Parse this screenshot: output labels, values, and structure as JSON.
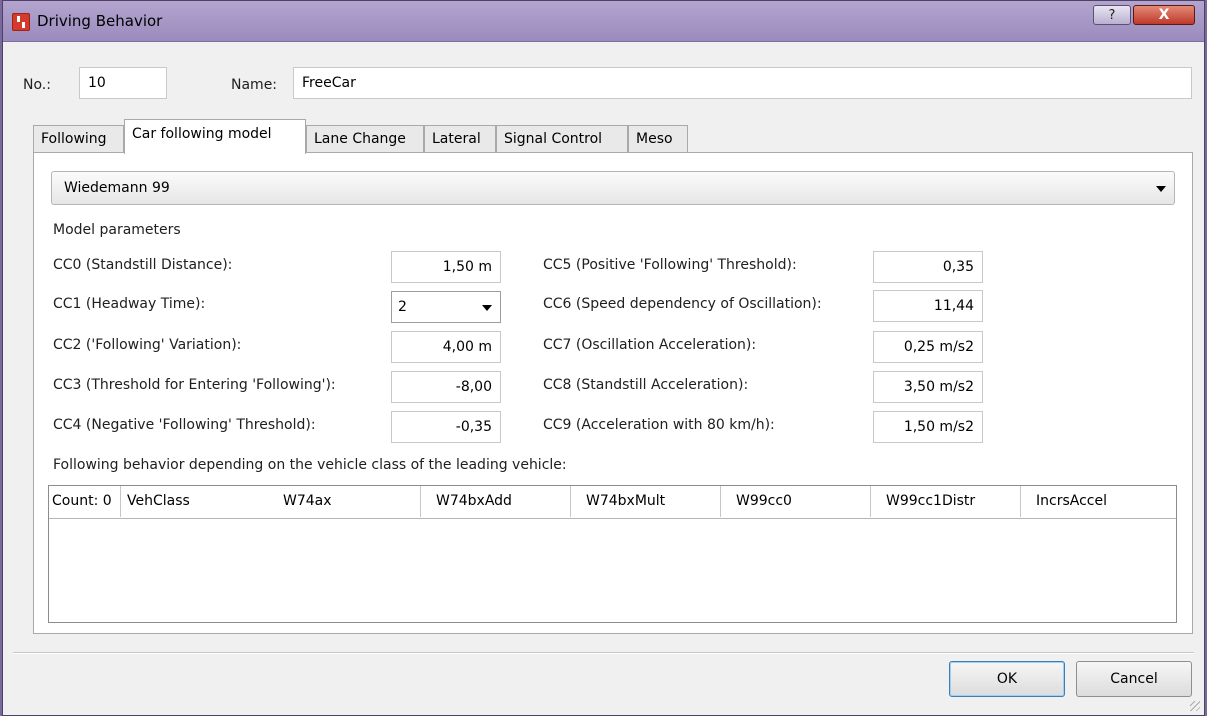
{
  "window": {
    "title": "Driving Behavior",
    "help_label": "?",
    "close_label": "X"
  },
  "header": {
    "no_label": "No.:",
    "no_value": "10",
    "name_label": "Name:",
    "name_value": "FreeCar"
  },
  "tabs": [
    {
      "label": "Following",
      "active": false
    },
    {
      "label": "Car following model",
      "active": true
    },
    {
      "label": "Lane Change",
      "active": false
    },
    {
      "label": "Lateral",
      "active": false
    },
    {
      "label": "Signal Control",
      "active": false
    },
    {
      "label": "Meso",
      "active": false
    }
  ],
  "model_select": {
    "value": "Wiedemann 99"
  },
  "model_parameters": {
    "heading": "Model parameters",
    "left": [
      {
        "label": "CC0 (Standstill Distance):",
        "value": "1,50 m"
      },
      {
        "label": "CC1 (Headway Time):",
        "value": "2"
      },
      {
        "label": "CC2 ('Following' Variation):",
        "value": "4,00 m"
      },
      {
        "label": "CC3 (Threshold for Entering 'Following'):",
        "value": "-8,00"
      },
      {
        "label": "CC4 (Negative 'Following' Threshold):",
        "value": "-0,35"
      }
    ],
    "right": [
      {
        "label": "CC5 (Positive 'Following' Threshold):",
        "value": "0,35"
      },
      {
        "label": "CC6 (Speed dependency of Oscillation):",
        "value": "11,44"
      },
      {
        "label": "CC7 (Oscillation Acceleration):",
        "value": "0,25 m/s2"
      },
      {
        "label": "CC8 (Standstill Acceleration):",
        "value": "3,50 m/s2"
      },
      {
        "label": "CC9 (Acceleration with 80 km/h):",
        "value": "1,50 m/s2"
      }
    ]
  },
  "vehicle_class_table": {
    "caption": "Following behavior depending on the vehicle class of the leading vehicle:",
    "count_label": "Count: 0",
    "columns": [
      "VehClass",
      "W74ax",
      "W74bxAdd",
      "W74bxMult",
      "W99cc0",
      "W99cc1Distr",
      "IncrsAccel"
    ],
    "rows": []
  },
  "buttons": {
    "ok": "OK",
    "cancel": "Cancel"
  },
  "colors": {
    "title_bar": "#a596c6",
    "close_button": "#c0392b",
    "app_icon": "#d43b2d"
  }
}
